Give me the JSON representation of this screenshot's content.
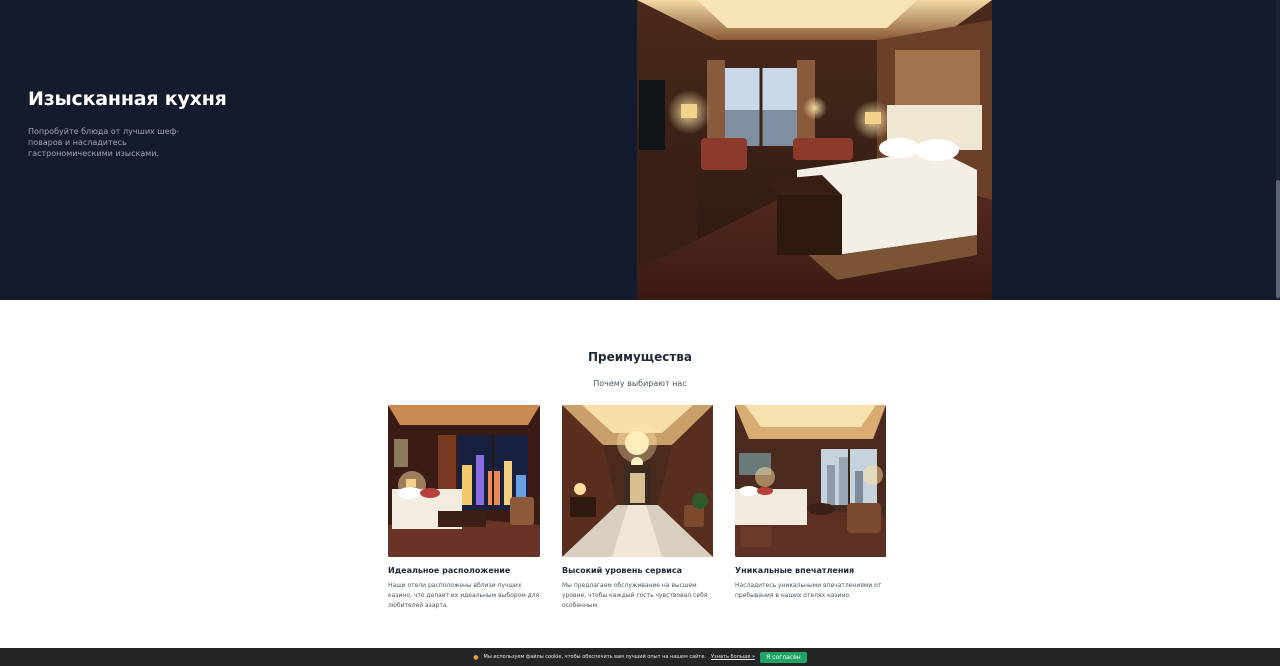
{
  "hero": {
    "title": "Изысканная кухня",
    "description": "Попробуйте блюда от лучших шеф-поваров и насладитесь гастрономическими изысками."
  },
  "advantages": {
    "title": "Преимущества",
    "subtitle": "Почему выбирают нас",
    "cards": [
      {
        "title": "Идеальное расположение",
        "text": "Наши отели расположены вблизи лучших казино, что делает их идеальным выбором для любителей азарта."
      },
      {
        "title": "Высокий уровень сервиса",
        "text": "Мы предлагаем обслуживание на высшем уровне, чтобы каждый гость чувствовал себя особенным."
      },
      {
        "title": "Уникальные впечатления",
        "text": "Насладитесь уникальными впечатлениями от пребывания в наших отелях казино."
      }
    ]
  },
  "cookie": {
    "icon": "cookie-icon",
    "text": "Мы используем файлы cookie, чтобы обеспечить вам лучший опыт на нашем сайте.",
    "link": "Узнать больше »",
    "accept": "Я согласен"
  }
}
